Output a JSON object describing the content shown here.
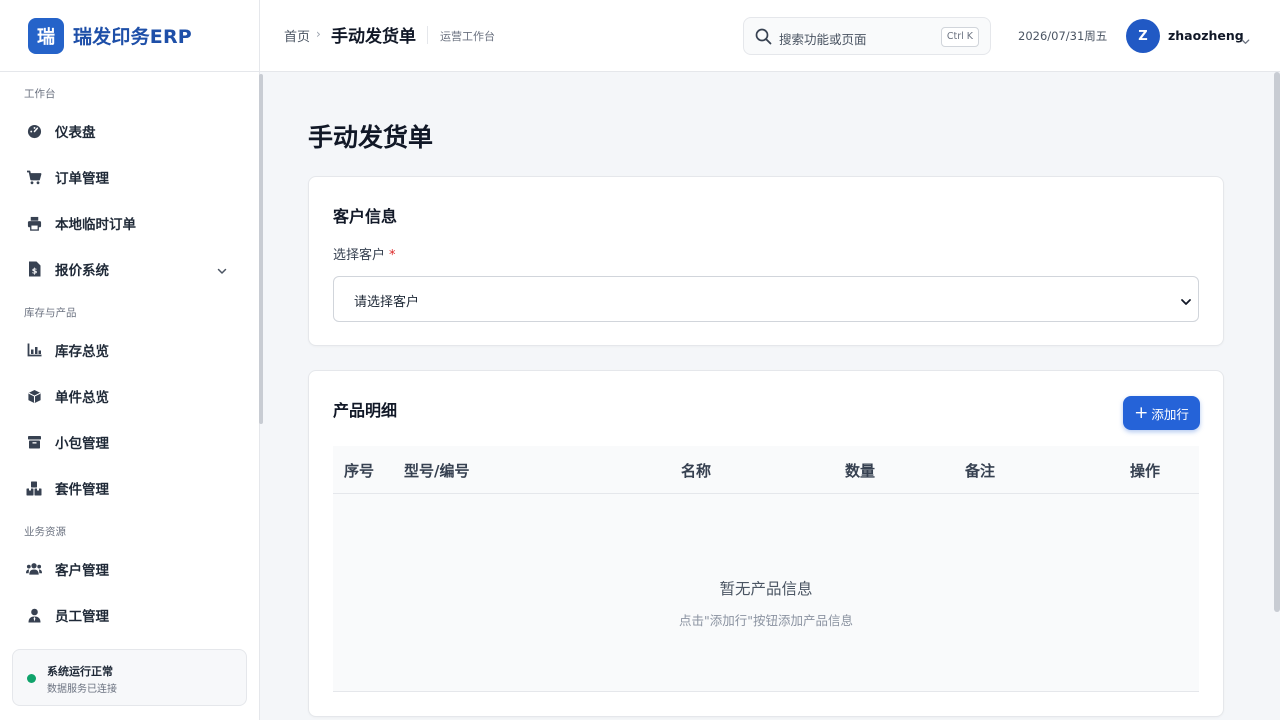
{
  "app": {
    "logo_char": "瑞",
    "name": "瑞发印务ERP"
  },
  "sidebar": {
    "groups": [
      {
        "label": "工作台"
      },
      {
        "label": "库存与产品"
      },
      {
        "label": "业务资源"
      }
    ],
    "items": [
      {
        "label": "仪表盘",
        "icon": "dashboard-icon"
      },
      {
        "label": "订单管理",
        "icon": "cart-icon"
      },
      {
        "label": "本地临时订单",
        "icon": "printer-icon"
      },
      {
        "label": "报价系统",
        "icon": "invoice-icon"
      },
      {
        "label": "库存总览",
        "icon": "chart-icon"
      },
      {
        "label": "单件总览",
        "icon": "box-icon"
      },
      {
        "label": "小包管理",
        "icon": "package-icon"
      },
      {
        "label": "套件管理",
        "icon": "boxes-icon"
      },
      {
        "label": "客户管理",
        "icon": "users-icon"
      },
      {
        "label": "员工管理",
        "icon": "user-icon"
      }
    ],
    "status": {
      "title": "系统运行正常",
      "subtitle": "数据服务已连接",
      "color": "#10a36b"
    }
  },
  "header": {
    "breadcrumb": {
      "home": "首页",
      "separator": "›",
      "current": "手动发货单",
      "context": "运营工作台"
    },
    "search": {
      "placeholder": "搜索功能或页面",
      "shortcut": "Ctrl K"
    },
    "date": "2026/07/31周五",
    "user": {
      "initial": "Z",
      "name": "zhaozheng"
    }
  },
  "page": {
    "title": "手动发货单",
    "customer_card": {
      "title": "客户信息",
      "select_label": "选择客户",
      "required_mark": "*",
      "select_value": "请选择客户"
    },
    "products_card": {
      "title": "产品明细",
      "add_button": "添加行",
      "columns": [
        "序号",
        "型号/编号",
        "名称",
        "数量",
        "备注",
        "操作"
      ],
      "empty_title": "暂无产品信息",
      "empty_hint": "点击\"添加行\"按钮添加产品信息"
    }
  },
  "colors": {
    "accent": "#2563d8",
    "logo_bg": "#2563c9",
    "required": "#dc2626"
  }
}
